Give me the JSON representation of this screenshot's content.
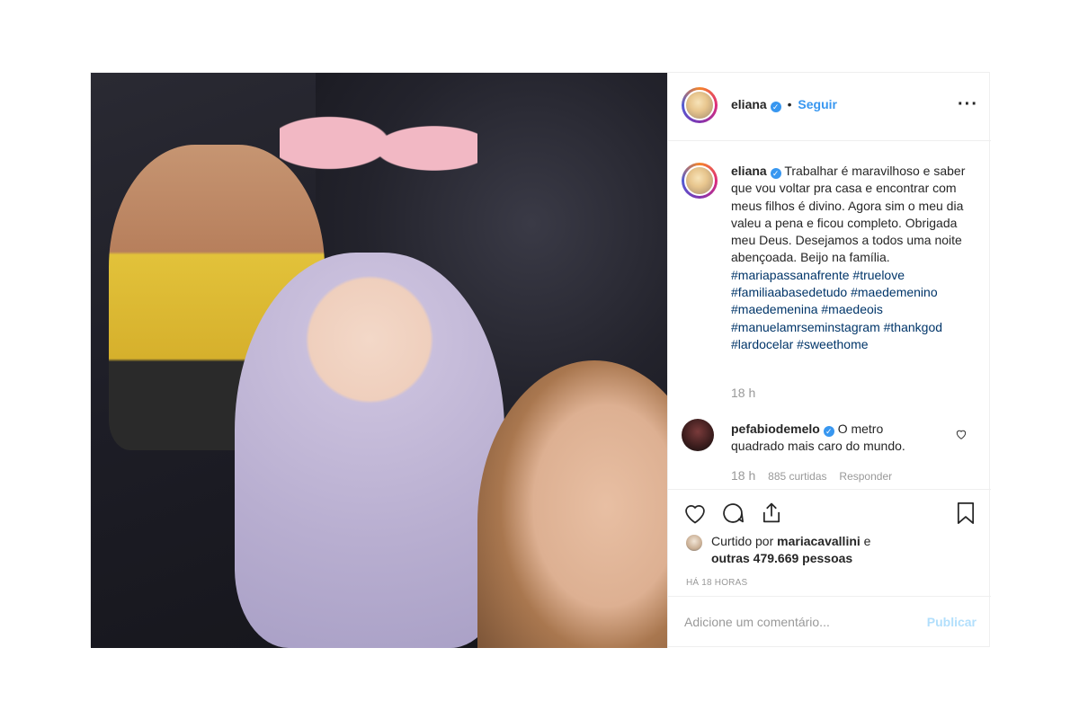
{
  "post": {
    "username": "eliana",
    "separator": "•",
    "follow_label": "Seguir",
    "more_label": "···",
    "photo_alt": "",
    "caption": {
      "username": "eliana",
      "text": "Trabalhar é maravilhoso e saber que vou voltar pra casa e encontrar com meus filhos é divino. Agora sim o meu dia valeu a pena e ficou completo. Obrigada meu Deus. Desejamos a todos uma noite abençoada. Beijo na família.",
      "hashtags": "#mariapassanafrente #truelove #familiaabasedetudo #maedemenino #maedemenina #maedeois #manuelamrseminstagram #thankgod #lardocelar #sweethome",
      "time": "18 h"
    },
    "comment": {
      "username": "pefabiodemelo",
      "text": "O metro quadrado mais caro do mundo.",
      "time": "18 h",
      "likes": "885 curtidas",
      "reply_label": "Responder"
    },
    "likes": {
      "prefix": "Curtido por",
      "user": "mariacavallini",
      "middle": "e",
      "others": "outras 479.669 pessoas"
    },
    "posted_ago": "HÁ 18 HORAS",
    "add_comment_placeholder": "Adicione um comentário...",
    "publish_label": "Publicar"
  },
  "colors": {
    "accent": "#3897f0",
    "hashtag": "#003569",
    "muted": "#999999",
    "publish_disabled": "#b2dffc"
  }
}
